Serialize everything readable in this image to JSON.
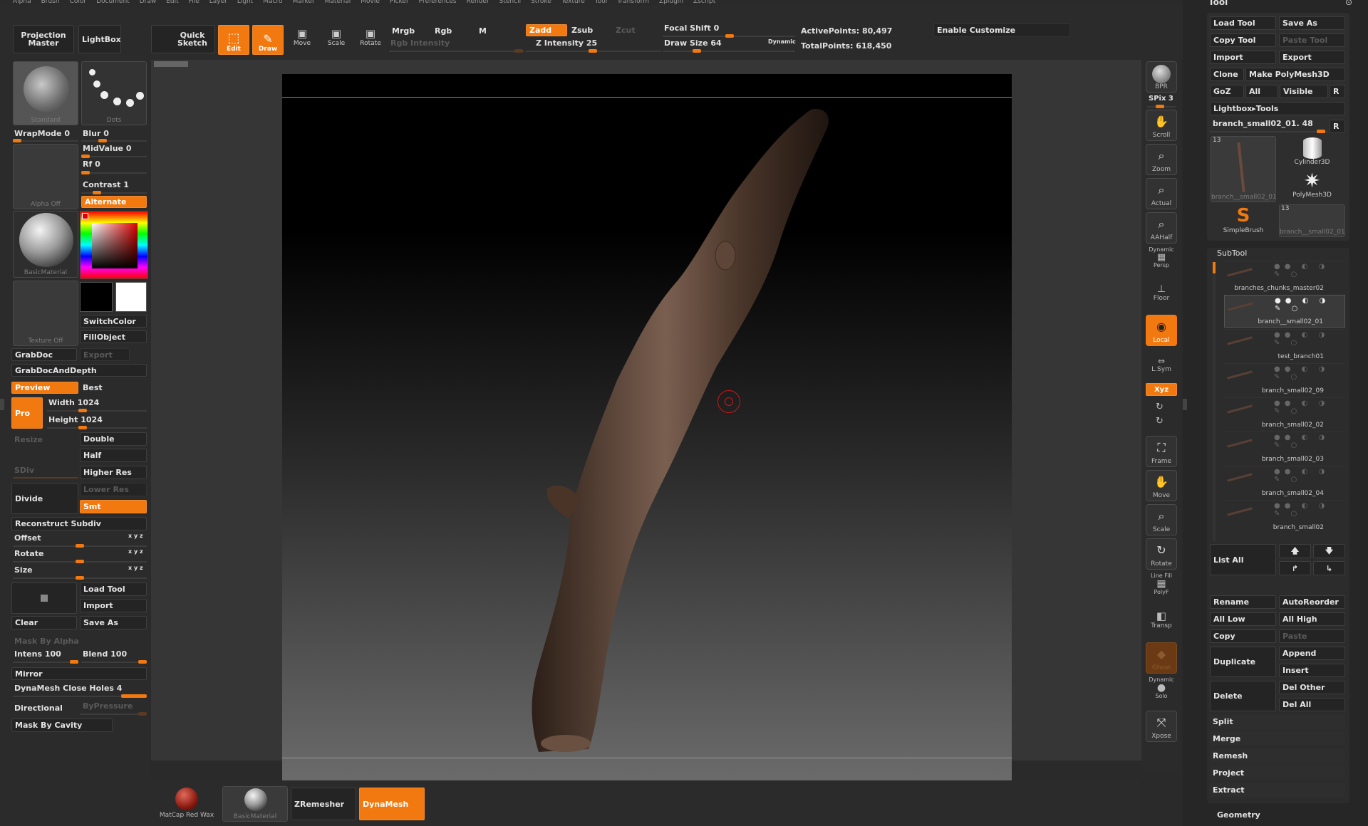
{
  "menu": [
    "Alpha",
    "Brush",
    "Color",
    "Document",
    "Draw",
    "Edit",
    "File",
    "Layer",
    "Light",
    "Macro",
    "Marker",
    "Material",
    "Movie",
    "Picker",
    "Preferences",
    "Render",
    "Stencil",
    "Stroke",
    "Texture",
    "Tool",
    "Transform",
    "Zplugin",
    "Zscript"
  ],
  "toolbar": {
    "projection_master": "Projection Master",
    "lightbox": "LightBox",
    "quick_sketch": "Quick Sketch",
    "edit": "Edit",
    "draw": "Draw",
    "move": "Move",
    "scale": "Scale",
    "rotate": "Rotate",
    "mrgb": "Mrgb",
    "rgb": "Rgb",
    "m": "M",
    "rgb_intensity": "Rgb Intensity",
    "zadd": "Zadd",
    "zsub": "Zsub",
    "zcut": "Zcut",
    "z_intensity": "Z Intensity 25",
    "focal_shift": "Focal Shift 0",
    "draw_size": "Draw Size 64",
    "dynamic": "Dynamic",
    "active_points": "ActivePoints: 80,497",
    "total_points": "TotalPoints: 618,450",
    "enable_customize": "Enable Customize"
  },
  "left": {
    "brush_cap": "Standard",
    "stroke_cap": "Dots",
    "wrapmode": "WrapMode 0",
    "blur": "Blur 0",
    "midvalue": "MidValue 0",
    "rf": "Rf 0",
    "contrast": "Contrast 1",
    "alternate": "Alternate",
    "alpha_cap": "Alpha Off",
    "material_cap": "BasicMaterial",
    "texture_cap": "Texture Off",
    "switchcolor": "SwitchColor",
    "fillobject": "FillObject",
    "grabdoc": "GrabDoc",
    "export": "Export",
    "grabdocanddepth": "GrabDocAndDepth",
    "preview": "Preview",
    "best": "Best",
    "pro": "Pro",
    "width": "Width",
    "width_val": "1024",
    "height": "Height",
    "height_val": "1024",
    "resize": "Resize",
    "double": "Double",
    "half": "Half",
    "higher_res": "Higher Res",
    "sdiv": "SDiv",
    "divide": "Divide",
    "lower_res": "Lower Res",
    "smt": "Smt",
    "reconstruct": "Reconstruct Subdiv",
    "offset": "Offset",
    "rotate": "Rotate",
    "size": "Size",
    "load_tool": "Load Tool",
    "import": "Import",
    "clear": "Clear",
    "save_as": "Save As",
    "mask_by_alpha": "Mask By Alpha",
    "intens": "Intens 100",
    "blend": "Blend 100",
    "mirror": "Mirror",
    "dynamesh_close": "DynaMesh Close Holes 4",
    "directional": "Directional",
    "bypressure": "ByPressure",
    "mask_by_cavity": "Mask By Cavity"
  },
  "right_icons": [
    "BPR",
    "SPix 3",
    "Scroll",
    "Zoom",
    "Actual",
    "AAHalf",
    "Dynamic",
    "Persp",
    "Floor",
    "Local",
    "L.Sym",
    "Xyz",
    "Frame",
    "Move",
    "Scale",
    "Rotate",
    "Line Fill",
    "PolyF",
    "Transp",
    "Ghost",
    "Dynamic",
    "Solo",
    "Xpose"
  ],
  "tool_panel": {
    "title": "Tool",
    "load_tool": "Load Tool",
    "save_as": "Save As",
    "copy_tool": "Copy Tool",
    "paste_tool": "Paste Tool",
    "import": "Import",
    "export": "Export",
    "clone": "Clone",
    "make_polymesh": "Make PolyMesh3D",
    "goz": "GoZ",
    "all": "All",
    "visible": "Visible",
    "r": "R",
    "lightbox_tools": "Lightbox▸Tools",
    "current_tool": "branch_small02_01. 48",
    "thumbs": [
      "branch__small02_01",
      "Cylinder3D",
      "PolyMesh3D",
      "SimpleBrush",
      "branch__small02_01"
    ],
    "thumb_count": "13",
    "subtool_title": "SubTool",
    "subtools": [
      "branches_chunks_master02",
      "branch__small02_01",
      "test_branch01",
      "branch_small02_09",
      "branch_small02_02",
      "branch_small02_03",
      "branch_small02_04",
      "branch_small02"
    ],
    "list_all": "List  All",
    "rename": "Rename",
    "autoreorder": "AutoReorder",
    "all_low": "All Low",
    "all_high": "All High",
    "copy": "Copy",
    "paste": "Paste",
    "duplicate": "Duplicate",
    "append": "Append",
    "insert": "Insert",
    "delete": "Delete",
    "del_other": "Del Other",
    "del_all": "Del All",
    "split": "Split",
    "merge": "Merge",
    "remesh": "Remesh",
    "project": "Project",
    "extract": "Extract",
    "geometry": "Geometry"
  },
  "bottom": {
    "matcap": "MatCap Red Wax",
    "basic": "BasicMaterial",
    "zremesher": "ZRemesher",
    "dynamesh": "DynaMesh"
  }
}
